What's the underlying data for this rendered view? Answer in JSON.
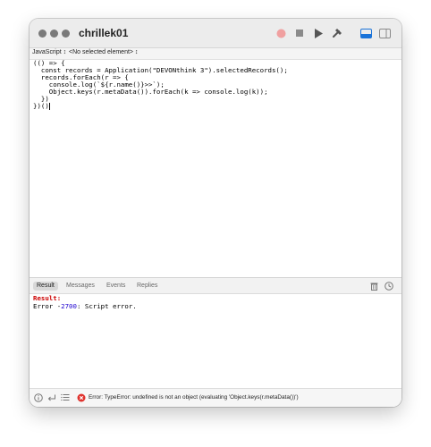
{
  "window": {
    "title": "chrillek01"
  },
  "selector": {
    "language": "JavaScript ↕",
    "element": "<No selected element> ↕"
  },
  "editor": {
    "lines": [
      "(() => {",
      "  const records = Application(\"DEVONthink 3\").selectedRecords();",
      "  records.forEach(r => {",
      "    console.log(`${r.name()}>>`);",
      "    Object.keys(r.metaData()).forEach(k => console.log(k));",
      "  })",
      "})()"
    ]
  },
  "result_tabs": [
    "Result",
    "Messages",
    "Events",
    "Replies"
  ],
  "result": {
    "label": "Result:",
    "error_prefix": "Error -",
    "error_code": "2700",
    "error_suffix": ": Script error."
  },
  "status": {
    "message": "Error: TypeError: undefined is not an object (evaluating 'Object.keys(r.metaData())')"
  },
  "icons": {
    "record": "record-button-icon",
    "stop": "stop-button-icon",
    "run": "run-button-icon",
    "compile": "hammer-icon",
    "layout_bottom": "show-bottom-pane-icon",
    "layout_side": "show-side-pane-icon",
    "trash": "trash-icon",
    "clock": "clock-icon",
    "info": "info-icon",
    "return": "return-arrow-icon",
    "list": "list-icon",
    "error": "error-icon"
  },
  "colors": {
    "record": "#f0a0a0",
    "accent": "#1a73d9",
    "error": "#cc0000",
    "keyword": "#aa0d91",
    "string": "#c41a16"
  }
}
